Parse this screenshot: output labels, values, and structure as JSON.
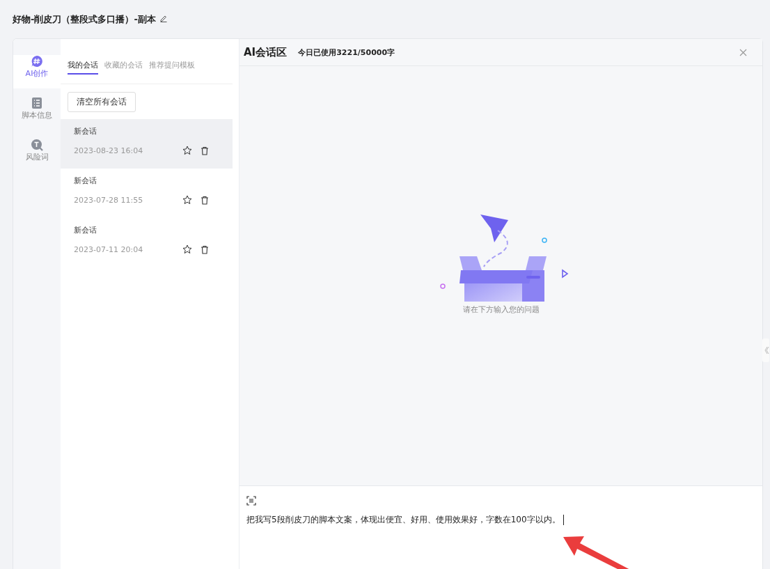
{
  "page_title": "好物-削皮刀（整段式多口播）-副本",
  "nav": [
    {
      "kind": "ai",
      "label": "AI创作",
      "selected": true
    },
    {
      "kind": "script",
      "label": "脚本信息",
      "selected": false
    },
    {
      "kind": "risk",
      "label": "风险词",
      "selected": false
    }
  ],
  "tabs": [
    {
      "label": "我的会话",
      "selected": true
    },
    {
      "label": "收藏的会话",
      "selected": false
    },
    {
      "label": "推荐提问模板",
      "selected": false
    }
  ],
  "clear_button": "清空所有会话",
  "sessions": [
    {
      "name": "新会话",
      "time": "2023-08-23 16:04",
      "selected": true
    },
    {
      "name": "新会话",
      "time": "2023-07-28 11:55",
      "selected": false
    },
    {
      "name": "新会话",
      "time": "2023-07-11 20:04",
      "selected": false
    }
  ],
  "chat": {
    "title": "AI会话区",
    "usage": "今日已使用3221/50000字",
    "empty_hint": "请在下方输入您的问题",
    "input_value": "把我写5段削皮刀的脚本文案，体现出便宜、好用、使用效果好，字数在100字以内。"
  }
}
